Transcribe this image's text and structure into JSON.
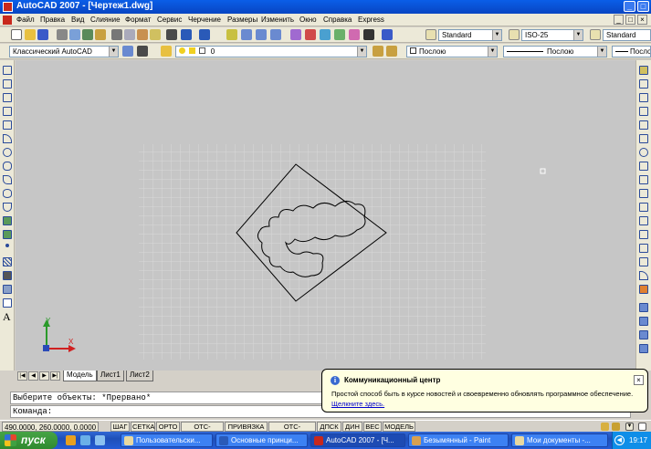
{
  "window": {
    "title": "AutoCAD 2007 - [Чертеж1.dwg]",
    "minimize": "_",
    "maximize": "□",
    "close": "×"
  },
  "menu": [
    "Файл",
    "Правка",
    "Вид",
    "Слияние",
    "Формат",
    "Сервис",
    "Черчение",
    "Размеры",
    "Изменить",
    "Окно",
    "Справка",
    "Express"
  ],
  "toolbar": {
    "text_style": "Standard",
    "dim_style": "ISO-25",
    "table_style": "Standard",
    "workspace": "Классический AutoCAD",
    "layer": "0",
    "color": "Послою",
    "linetype": "Послою",
    "lineweight": "Послою"
  },
  "ucs": {
    "x_label": "X",
    "y_label": "Y"
  },
  "tabs": [
    "Модель",
    "Лист1",
    "Лист2"
  ],
  "active_tab": "Модель",
  "command": {
    "history": "Выберите объекты: *Прервано*",
    "prompt": "Команда:"
  },
  "balloon": {
    "title": "Коммуникационный центр",
    "text": "Простой способ быть в курсе новостей и своевременно обновлять программное обеспечение.",
    "link": "Щелкните здесь.",
    "close": "×"
  },
  "status": {
    "coords": "490.0000, 260.0000, 0.0000",
    "buttons": [
      "ШАГ",
      "СЕТКА",
      "ОРТО",
      "ОТС-ПОЛЯР",
      "ПРИВЯЗКА",
      "ОТС-ОБЪЕКТ",
      "ДПСК",
      "ДИН",
      "ВЕС",
      "МОДЕЛЬ"
    ]
  },
  "taskbar": {
    "start": "пуск",
    "tasks": [
      "Пользовательски...",
      "Основные принци...",
      "AutoCAD 2007 - [Ч...",
      "Безымянный - Paint",
      "Мои документы -..."
    ],
    "clock": "19:17"
  }
}
